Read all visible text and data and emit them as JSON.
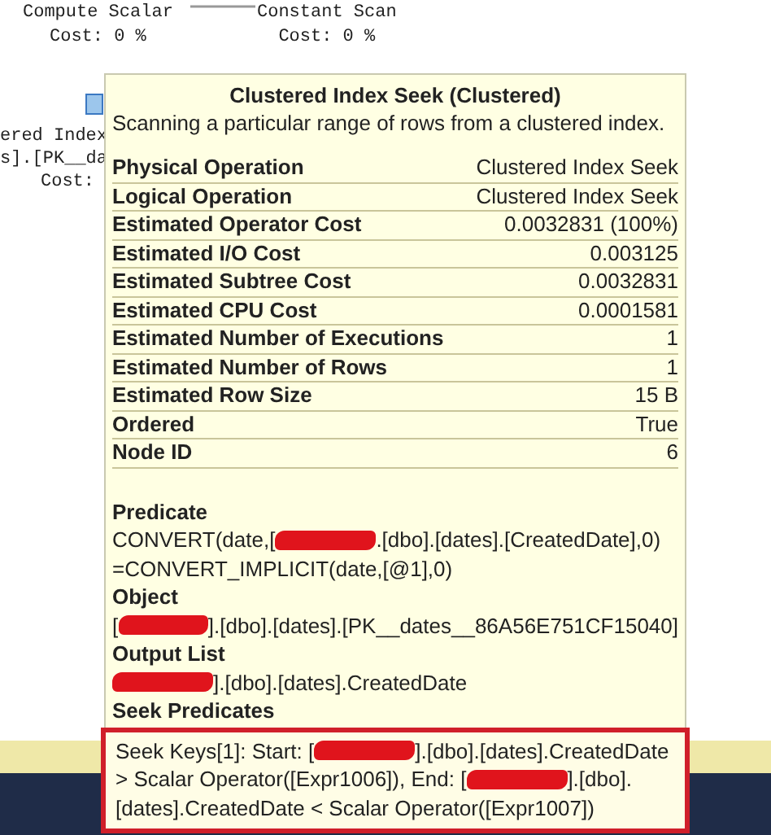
{
  "plan_nodes": [
    {
      "name": "Compute Scalar",
      "cost": "Cost: 0 %"
    },
    {
      "name": "Constant Scan",
      "cost": "Cost: 0 %"
    }
  ],
  "partial_node": {
    "lines": [
      "ered Index",
      "s].[PK__da",
      "Cost:"
    ]
  },
  "tooltip": {
    "title": "Clustered Index Seek (Clustered)",
    "description": "Scanning a particular range of rows from a clustered index.",
    "properties": [
      {
        "label": "Physical Operation",
        "value": "Clustered Index Seek"
      },
      {
        "label": "Logical Operation",
        "value": "Clustered Index Seek"
      },
      {
        "label": "Estimated Operator Cost",
        "value": "0.0032831 (100%)"
      },
      {
        "label": "Estimated I/O Cost",
        "value": "0.003125"
      },
      {
        "label": "Estimated Subtree Cost",
        "value": "0.0032831"
      },
      {
        "label": "Estimated CPU Cost",
        "value": "0.0001581"
      },
      {
        "label": "Estimated Number of Executions",
        "value": "1"
      },
      {
        "label": "Estimated Number of Rows",
        "value": "1"
      },
      {
        "label": "Estimated Row Size",
        "value": "15 B"
      },
      {
        "label": "Ordered",
        "value": "True"
      },
      {
        "label": "Node ID",
        "value": "6"
      }
    ],
    "sections": [
      {
        "label": "Predicate",
        "highlighted": false,
        "lines": [
          [
            {
              "kind": "text",
              "text": "CONVERT(date,["
            },
            {
              "kind": "redacted"
            },
            {
              "kind": "text",
              "text": ".[dbo].[dates].[CreatedDate],0)"
            }
          ],
          [
            {
              "kind": "text",
              "text": "=CONVERT_IMPLICIT(date,[@1],0)"
            }
          ]
        ]
      },
      {
        "label": "Object",
        "highlighted": false,
        "lines": [
          [
            {
              "kind": "text",
              "text": "["
            },
            {
              "kind": "redacted"
            },
            {
              "kind": "text",
              "text": "].[dbo].[dates].[PK__dates__86A56E751CF15040]"
            }
          ]
        ]
      },
      {
        "label": "Output List",
        "highlighted": false,
        "lines": [
          [
            {
              "kind": "redacted"
            },
            {
              "kind": "text",
              "text": "].[dbo].[dates].CreatedDate"
            }
          ]
        ]
      },
      {
        "label": "Seek Predicates",
        "highlighted": true,
        "lines": [
          [
            {
              "kind": "text",
              "text": "Seek Keys[1]: Start: ["
            },
            {
              "kind": "redacted"
            },
            {
              "kind": "text",
              "text": "].[dbo].[dates].CreatedDate"
            }
          ],
          [
            {
              "kind": "text",
              "text": "> Scalar Operator([Expr1006]), End: ["
            },
            {
              "kind": "redacted"
            },
            {
              "kind": "text",
              "text": "].[dbo]."
            }
          ],
          [
            {
              "kind": "text",
              "text": "[dates].CreatedDate < Scalar Operator([Expr1007])"
            }
          ]
        ]
      }
    ]
  }
}
